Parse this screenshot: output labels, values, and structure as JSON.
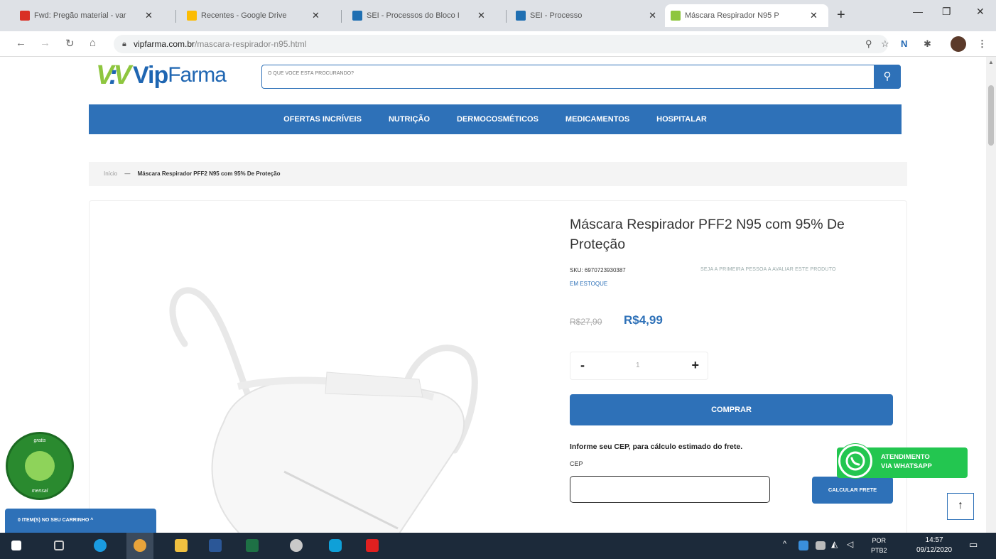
{
  "browser": {
    "tabs": [
      {
        "title": "Fwd: Pregão material - var",
        "icon_color": "#d93025"
      },
      {
        "title": "Recentes - Google Drive",
        "icon_color": "#fbbc04"
      },
      {
        "title": "SEI - Processos do Bloco I",
        "icon_color": "#1f6fb2"
      },
      {
        "title": "SEI - Processo",
        "icon_color": "#1f6fb2"
      },
      {
        "title": "Máscara Respirador N95 P",
        "icon_color": "#8ec63f",
        "active": true
      }
    ],
    "url_domain": "vipfarma.com.br",
    "url_path": "/mascara-respirador-n95.html",
    "new_tab_symbol": "+"
  },
  "site": {
    "logo_vip": "Vip",
    "logo_farma": "Farma",
    "search_placeholder": "O QUE VOCÊ ESTÁ PROCURANDO?",
    "menu": [
      "OFERTAS INCRÍVEIS",
      "NUTRIÇÃO",
      "DERMOCOSMÉTICOS",
      "MEDICAMENTOS",
      "HOSPITALAR"
    ],
    "breadcrumb": {
      "home": "Início",
      "separator": "—",
      "current": "Máscara Respirador PFF2 N95 com 95% De Proteção"
    }
  },
  "product": {
    "title": "Máscara Respirador PFF2 N95 com 95% De Proteção",
    "sku": "SKU: 6970723930387",
    "review_link": "SEJA A PRIMEIRA PESSOA A AVALIAR ESTE PRODUTO",
    "stock": "EM ESTOQUE",
    "old_price": "R$27,90",
    "price": "R$4,99",
    "qty_minus": "-",
    "qty_value": "1",
    "qty_plus": "+",
    "buy_label": "COMPRAR",
    "cep_info": "Informe seu CEP, para cálculo estimado do frete.",
    "cep_label": "CEP",
    "calc_label": "CALCULAR FRETE"
  },
  "widgets": {
    "whatsapp_line1": "ATENDIMENTO",
    "whatsapp_line2": "VIA WHATSAPP",
    "to_top": "↑",
    "cart_label": "0 ITEM(S) NO SEU CARRINHO ^",
    "seal_top": "gratis",
    "seal_bottom": "mensal"
  },
  "taskbar": {
    "lang_top": "POR",
    "lang_bottom": "PTB2",
    "time": "14:57",
    "date": "09/12/2020"
  },
  "colors": {
    "brand_blue": "#2e71b8",
    "brand_green": "#8ec63f",
    "whatsapp_green": "#23c650"
  }
}
